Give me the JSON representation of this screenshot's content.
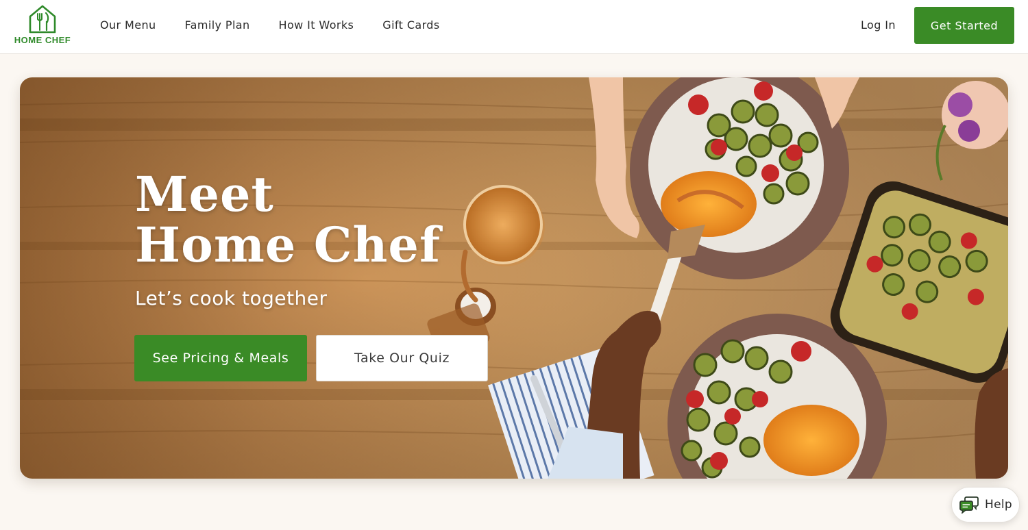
{
  "brand": {
    "logo_text": "HOME CHEF",
    "logo_icon": "house-fork-knife-icon",
    "color_primary": "#3a8b26"
  },
  "nav": {
    "links": [
      {
        "label": "Our Menu"
      },
      {
        "label": "Family Plan"
      },
      {
        "label": "How It Works"
      },
      {
        "label": "Gift Cards"
      }
    ],
    "login_label": "Log In",
    "cta_label": "Get Started"
  },
  "hero": {
    "title_line1": "Meet",
    "title_line2": "Home Chef",
    "subtitle": "Let’s cook together",
    "primary_button": "See Pricing & Meals",
    "secondary_button": "Take Our Quiz",
    "background": "wooden table with plated zucchini, tomatoes and cheesy chicken dishes"
  },
  "help": {
    "label": "Help",
    "icon": "chat-bubbles-icon"
  }
}
